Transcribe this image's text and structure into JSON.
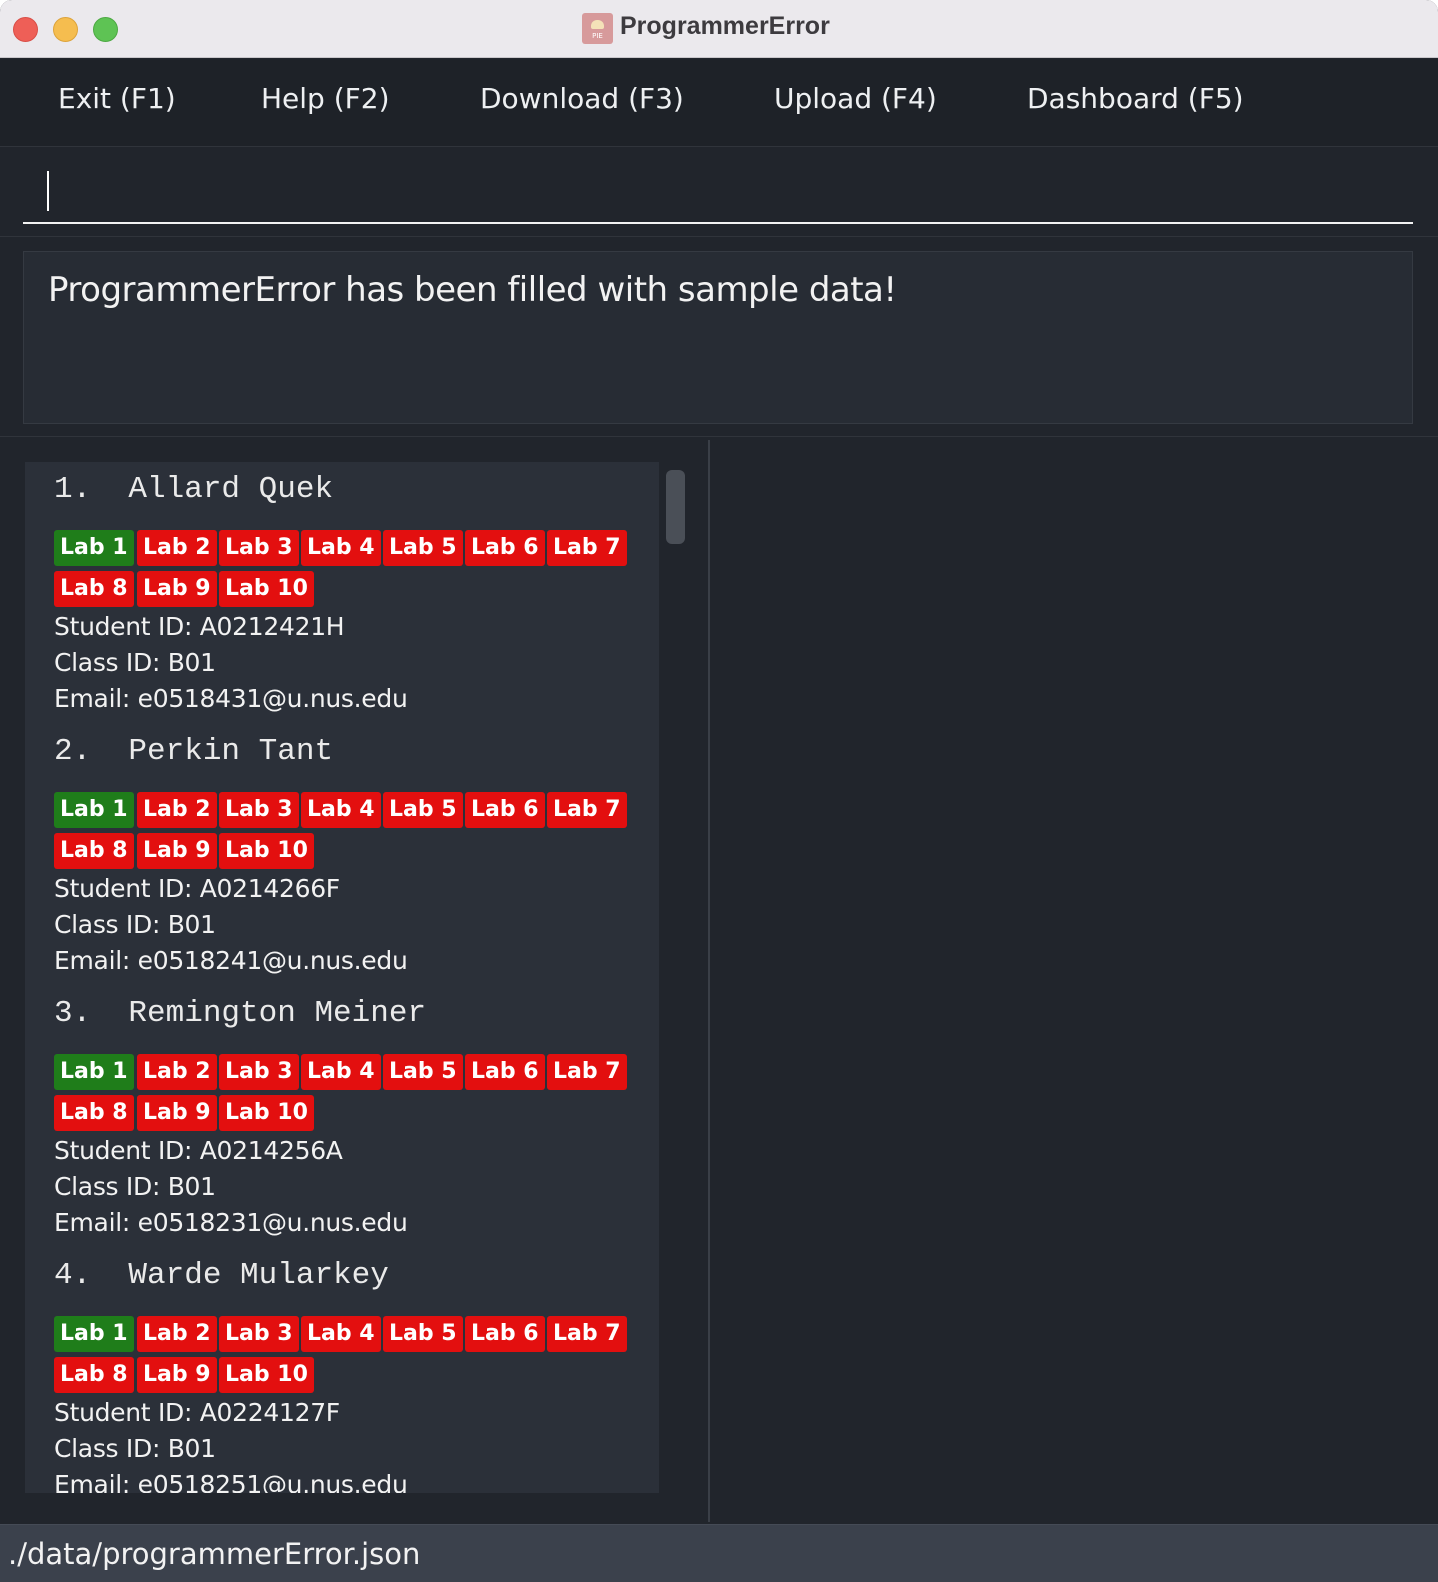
{
  "window": {
    "title": "ProgrammerError",
    "icon_label": "PIE"
  },
  "menu": {
    "items": [
      {
        "label": "Exit (F1)"
      },
      {
        "label": "Help (F2)"
      },
      {
        "label": "Download (F3)"
      },
      {
        "label": "Upload (F4)"
      },
      {
        "label": "Dashboard (F5)"
      }
    ]
  },
  "command": {
    "value": "",
    "placeholder": ""
  },
  "result": {
    "message": "ProgrammerError has been filled with sample data!"
  },
  "students": [
    {
      "name": "1.  Allard Quek",
      "labs": [
        {
          "label": "Lab 1",
          "status": "done"
        },
        {
          "label": "Lab 2",
          "status": "pending"
        },
        {
          "label": "Lab 3",
          "status": "pending"
        },
        {
          "label": "Lab 4",
          "status": "pending"
        },
        {
          "label": "Lab 5",
          "status": "pending"
        },
        {
          "label": "Lab 6",
          "status": "pending"
        },
        {
          "label": "Lab 7",
          "status": "pending"
        },
        {
          "label": "Lab 8",
          "status": "pending"
        },
        {
          "label": "Lab 9",
          "status": "pending"
        },
        {
          "label": "Lab 10",
          "status": "pending"
        }
      ],
      "student_id": "Student ID: A0212421H",
      "class_id": "Class ID: B01",
      "email": "Email: e0518431@u.nus.edu"
    },
    {
      "name": "2.  Perkin Tant",
      "labs": [
        {
          "label": "Lab 1",
          "status": "done"
        },
        {
          "label": "Lab 2",
          "status": "pending"
        },
        {
          "label": "Lab 3",
          "status": "pending"
        },
        {
          "label": "Lab 4",
          "status": "pending"
        },
        {
          "label": "Lab 5",
          "status": "pending"
        },
        {
          "label": "Lab 6",
          "status": "pending"
        },
        {
          "label": "Lab 7",
          "status": "pending"
        },
        {
          "label": "Lab 8",
          "status": "pending"
        },
        {
          "label": "Lab 9",
          "status": "pending"
        },
        {
          "label": "Lab 10",
          "status": "pending"
        }
      ],
      "student_id": "Student ID: A0214266F",
      "class_id": "Class ID: B01",
      "email": "Email: e0518241@u.nus.edu"
    },
    {
      "name": "3.  Remington Meiner",
      "labs": [
        {
          "label": "Lab 1",
          "status": "done"
        },
        {
          "label": "Lab 2",
          "status": "pending"
        },
        {
          "label": "Lab 3",
          "status": "pending"
        },
        {
          "label": "Lab 4",
          "status": "pending"
        },
        {
          "label": "Lab 5",
          "status": "pending"
        },
        {
          "label": "Lab 6",
          "status": "pending"
        },
        {
          "label": "Lab 7",
          "status": "pending"
        },
        {
          "label": "Lab 8",
          "status": "pending"
        },
        {
          "label": "Lab 9",
          "status": "pending"
        },
        {
          "label": "Lab 10",
          "status": "pending"
        }
      ],
      "student_id": "Student ID: A0214256A",
      "class_id": "Class ID: B01",
      "email": "Email: e0518231@u.nus.edu"
    },
    {
      "name": "4.  Warde Mularkey",
      "labs": [
        {
          "label": "Lab 1",
          "status": "done"
        },
        {
          "label": "Lab 2",
          "status": "pending"
        },
        {
          "label": "Lab 3",
          "status": "pending"
        },
        {
          "label": "Lab 4",
          "status": "pending"
        },
        {
          "label": "Lab 5",
          "status": "pending"
        },
        {
          "label": "Lab 6",
          "status": "pending"
        },
        {
          "label": "Lab 7",
          "status": "pending"
        },
        {
          "label": "Lab 8",
          "status": "pending"
        },
        {
          "label": "Lab 9",
          "status": "pending"
        },
        {
          "label": "Lab 10",
          "status": "pending"
        }
      ],
      "student_id": "Student ID: A0224127F",
      "class_id": "Class ID: B01",
      "email": "Email: e0518251@u.nus.edu"
    }
  ],
  "status_bar": {
    "path": "./data/programmerError.json"
  },
  "colors": {
    "background": "#21252c",
    "lab_done": "#1f7d1a",
    "lab_pending": "#e30f0f",
    "status_bar": "#3b414c"
  }
}
